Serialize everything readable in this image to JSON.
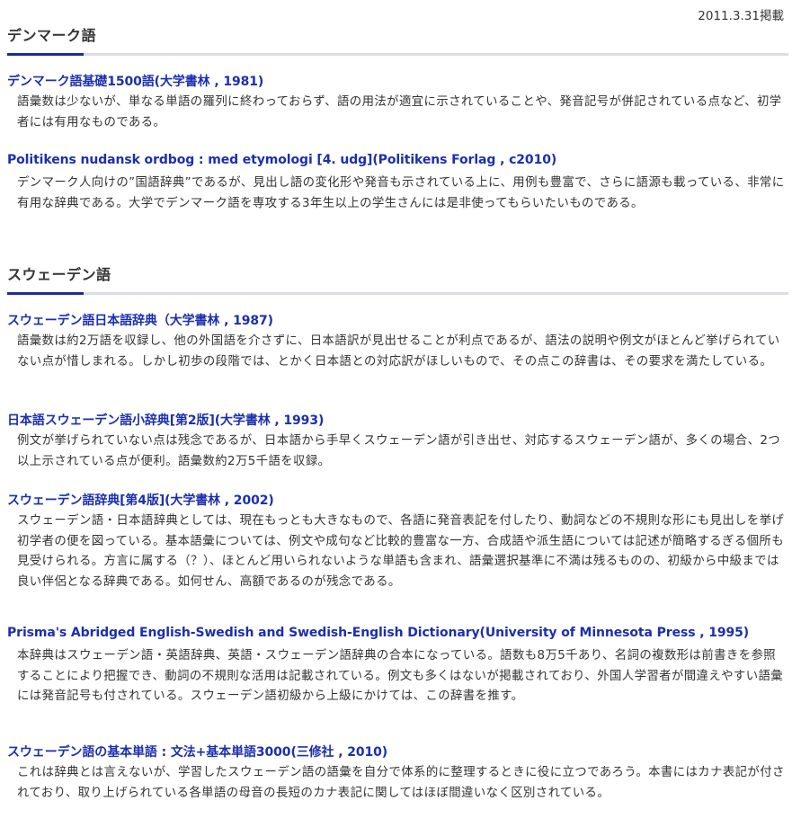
{
  "published": "2011.3.31掲載",
  "sections": [
    {
      "title": "デンマーク語",
      "entries": [
        {
          "title": "デンマーク語基礎1500語(大学書林 , 1981)",
          "description": "語彙数は少ないが、単なる単語の羅列に終わっておらず、語の用法が適宜に示されていることや、発音記号が併記されている点など、初学者には有用なものである。"
        },
        {
          "title": "Politikens nudansk ordbog : med etymologi [4. udg](Politikens Forlag , c2010)",
          "description": "デンマーク人向けの”国語辞典”であるが、見出し語の変化形や発音も示されている上に、用例も豊富で、さらに語源も載っている、非常に有用な辞典である。大学でデンマーク語を専攻する3年生以上の学生さんには是非使ってもらいたいものである。"
        }
      ]
    },
    {
      "title": "スウェーデン語",
      "entries": [
        {
          "title": "スウェーデン語日本語辞典（大学書林 , 1987)",
          "description": "語彙数は約2万語を収録し、他の外国語を介さずに、日本語訳が見出せることが利点であるが、語法の説明や例文がほとんど挙げられていない点が惜しまれる。しかし初歩の段階では、とかく日本語との対応訳がほしいもので、その点この辞書は、その要求を満たしている。"
        },
        {
          "title": "日本語スウェーデン語小辞典[第2版](大学書林 , 1993)",
          "description": "例文が挙げられていない点は残念であるが、日本語から手早くスウェーデン語が引き出せ、対応するスウェーデン語が、多くの場合、2つ以上示されている点が便利。語彙数約2万5千語を収録。"
        },
        {
          "title": "スウェーデン語辞典[第4版](大学書林 , 2002)",
          "description": "スウェーデン語・日本語辞典としては、現在もっとも大きなもので、各語に発音表記を付したり、動詞などの不規則な形にも見出しを挙げ初学者の便を図っている。基本語彙については、例文や成句など比較的豊富な一方、合成語や派生語については記述が簡略するぎる個所も見受けられる。方言に属する（？）、ほとんど用いられないような単語も含まれ、語彙選択基準に不満は残るものの、初級から中級までは良い伴侶となる辞典である。如何せん、高額であるのが残念である。"
        },
        {
          "title": "Prisma's Abridged English-Swedish and Swedish-English Dictionary(University of Minnesota Press , 1995)",
          "description": "本辞典はスウェーデン語・英語辞典、英語・スウェーデン語辞典の合本になっている。語数も8万5千あり、名詞の複数形は前書きを参照することにより把握でき、動詞の不規則な活用は記載されている。例文も多くはないが掲載されており、外国人学習者が間違えやすい語彙には発音記号も付されている。スウェーデン語初級から上級にかけては、この辞書を推す。"
        },
        {
          "title": "スウェーデン語の基本単語 : 文法+基本単語3000(三修社 , 2010)",
          "description": "これは辞典とは言えないが、学習したスウェーデン語の語彙を自分で体系的に整理するときに役に立つであろう。本書にはカナ表記が付されており、取り上げられている各単語の母音の長短のカナ表記に関してはほぼ間違いなく区別されている。"
        }
      ]
    }
  ]
}
